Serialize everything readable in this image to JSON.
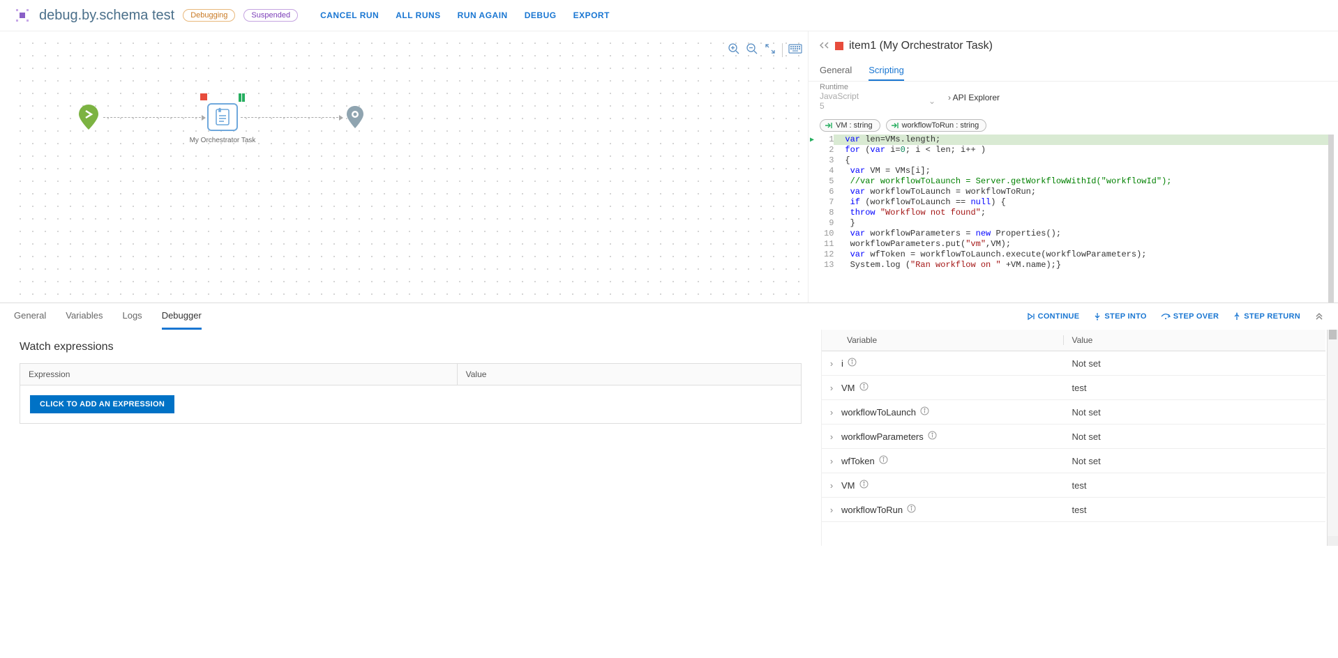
{
  "header": {
    "title": "debug.by.schema test",
    "badges": {
      "debugging": "Debugging",
      "suspended": "Suspended"
    },
    "actions": {
      "cancel_run": "CANCEL RUN",
      "all_runs": "ALL RUNS",
      "run_again": "RUN AGAIN",
      "debug": "DEBUG",
      "export": "EXPORT"
    }
  },
  "canvas": {
    "task_label": "My Orchestrator Task"
  },
  "detail": {
    "title": "item1 (My Orchestrator Task)",
    "tabs": {
      "general": "General",
      "scripting": "Scripting"
    },
    "runtime_label": "Runtime",
    "runtime_value": "JavaScript 5",
    "api_explorer": "API Explorer",
    "params": {
      "vm": "VM : string",
      "workflow": "workflowToRun : string"
    },
    "code_lines": [
      "var len=VMs.length;",
      "for (var i=0; i < len; i++ )",
      "{",
      " var VM = VMs[i];",
      " //var workflowToLaunch = Server.getWorkflowWithId(\"workflowId\");",
      " var workflowToLaunch = workflowToRun;",
      " if (workflowToLaunch == null) {",
      " throw \"Workflow not found\";",
      " }",
      " var workflowParameters = new Properties();",
      " workflowParameters.put(\"vm\",VM);",
      " var wfToken = workflowToLaunch.execute(workflowParameters);",
      " System.log (\"Ran workflow on \" +VM.name);}"
    ]
  },
  "bottom_tabs": {
    "general": "General",
    "variables": "Variables",
    "logs": "Logs",
    "debugger": "Debugger"
  },
  "debug_actions": {
    "continue": "CONTINUE",
    "step_into": "STEP INTO",
    "step_over": "STEP OVER",
    "step_return": "STEP RETURN"
  },
  "watch": {
    "title": "Watch expressions",
    "col_expression": "Expression",
    "col_value": "Value",
    "add_button": "CLICK TO ADD AN EXPRESSION"
  },
  "vars": {
    "col_variable": "Variable",
    "col_value": "Value",
    "rows": [
      {
        "name": "i",
        "value": "Not set"
      },
      {
        "name": "VM",
        "value": "test"
      },
      {
        "name": "workflowToLaunch",
        "value": "Not set"
      },
      {
        "name": "workflowParameters",
        "value": "Not set"
      },
      {
        "name": "wfToken",
        "value": "Not set"
      },
      {
        "name": "VM",
        "value": "test"
      },
      {
        "name": "workflowToRun",
        "value": "test"
      }
    ]
  }
}
